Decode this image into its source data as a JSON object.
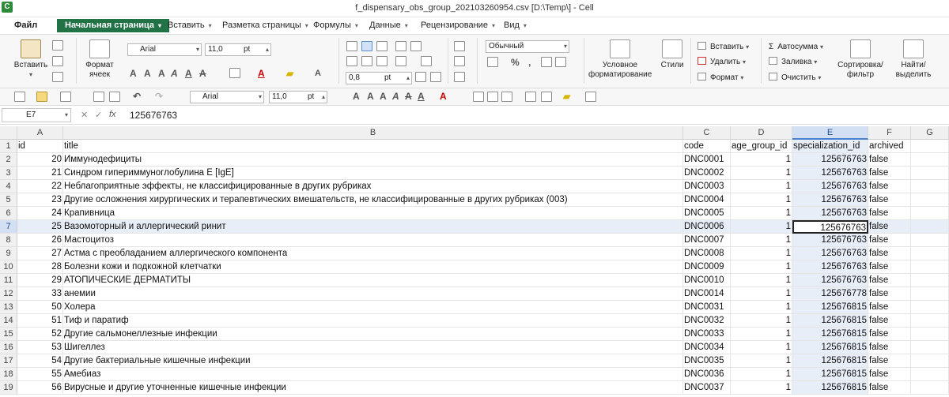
{
  "window": {
    "title": "f_dispensary_obs_group_202103260954.csv [D:\\Temp\\] - Cell"
  },
  "menu": {
    "file": "Файл",
    "tabs": [
      "Начальная страница",
      "Вставить",
      "Разметка страницы",
      "Формулы",
      "Данные",
      "Рецензирование",
      "Вид"
    ]
  },
  "ribbon": {
    "paste": "Вставить",
    "format_cells": [
      "Формат",
      "ячеек"
    ],
    "font": "Arial",
    "font_size": "11,0",
    "unit": "pt",
    "indent": "0,8",
    "number_format": "Обычный",
    "conditional": [
      "Условное",
      "форматирование"
    ],
    "styles": "Стили",
    "insert": "Вставить",
    "delete": "Удалить",
    "format": "Формат",
    "autosum": "Автосумма",
    "fill": "Заливка",
    "clear": "Очистить",
    "sort": [
      "Сортировка/",
      "фильтр"
    ],
    "find": [
      "Найти/",
      "выделить"
    ],
    "percent": "%",
    "thousands": ","
  },
  "toolbar2": {
    "font": "Arial",
    "font_size": "11,0",
    "unit": "pt"
  },
  "formula_bar": {
    "cell_ref": "E7",
    "fx": "fx",
    "value": "125676763"
  },
  "columns": [
    "A",
    "B",
    "C",
    "D",
    "E",
    "F",
    "G"
  ],
  "selected_column": "E",
  "selected_row": 7,
  "rows": [
    {
      "n": 1,
      "a": "id",
      "b": "title",
      "c": "code",
      "d": "age_group_id",
      "e": "specialization_id",
      "f": "archived",
      "header": true
    },
    {
      "n": 2,
      "a": "20",
      "b": "Иммунодефициты",
      "c": "DNC0001",
      "d": "1",
      "e": "125676763",
      "f": "false"
    },
    {
      "n": 3,
      "a": "21",
      "b": "Синдром гипериммуноглобулина Е [IgE]",
      "c": "DNC0002",
      "d": "1",
      "e": "125676763",
      "f": "false"
    },
    {
      "n": 4,
      "a": "22",
      "b": "Неблагоприятные эффекты, не классифицированные в других рубриках",
      "c": "DNC0003",
      "d": "1",
      "e": "125676763",
      "f": "false"
    },
    {
      "n": 5,
      "a": "23",
      "b": "Другие осложнения хирургических и терапевтических вмешательств, не классифицированные в других рубриках (003)",
      "c": "DNC0004",
      "d": "1",
      "e": "125676763",
      "f": "false"
    },
    {
      "n": 6,
      "a": "24",
      "b": "Крапивница",
      "c": "DNC0005",
      "d": "1",
      "e": "125676763",
      "f": "false"
    },
    {
      "n": 7,
      "a": "25",
      "b": "Вазомоторный и аллергический ринит",
      "c": "DNC0006",
      "d": "1",
      "e": "125676763",
      "f": "false"
    },
    {
      "n": 8,
      "a": "26",
      "b": "Мастоцитоз",
      "c": "DNC0007",
      "d": "1",
      "e": "125676763",
      "f": "false"
    },
    {
      "n": 9,
      "a": "27",
      "b": "Астма с преобладанием аллергического компонента",
      "c": "DNC0008",
      "d": "1",
      "e": "125676763",
      "f": "false"
    },
    {
      "n": 10,
      "a": "28",
      "b": "Болезни кожи и подкожной клетчатки",
      "c": "DNC0009",
      "d": "1",
      "e": "125676763",
      "f": "false"
    },
    {
      "n": 11,
      "a": "29",
      "b": "АТОПИЧЕСКИЕ ДЕРМАТИТЫ",
      "c": "DNC0010",
      "d": "1",
      "e": "125676763",
      "f": "false"
    },
    {
      "n": 12,
      "a": "33",
      "b": "анемии",
      "c": "DNC0014",
      "d": "1",
      "e": "125676778",
      "f": "false"
    },
    {
      "n": 13,
      "a": "50",
      "b": "Холера",
      "c": "DNC0031",
      "d": "1",
      "e": "125676815",
      "f": "false"
    },
    {
      "n": 14,
      "a": "51",
      "b": "Тиф и паратиф",
      "c": "DNC0032",
      "d": "1",
      "e": "125676815",
      "f": "false"
    },
    {
      "n": 15,
      "a": "52",
      "b": "Другие сальмонеллезные инфекции",
      "c": "DNC0033",
      "d": "1",
      "e": "125676815",
      "f": "false"
    },
    {
      "n": 16,
      "a": "53",
      "b": "Шигеллез",
      "c": "DNC0034",
      "d": "1",
      "e": "125676815",
      "f": "false"
    },
    {
      "n": 17,
      "a": "54",
      "b": "Другие бактериальные кишечные инфекции",
      "c": "DNC0035",
      "d": "1",
      "e": "125676815",
      "f": "false"
    },
    {
      "n": 18,
      "a": "55",
      "b": "Амебиаз",
      "c": "DNC0036",
      "d": "1",
      "e": "125676815",
      "f": "false"
    },
    {
      "n": 19,
      "a": "56",
      "b": "Вирусные и другие уточненные кишечные инфекции",
      "c": "DNC0037",
      "d": "1",
      "e": "125676815",
      "f": "false"
    }
  ],
  "colors": {
    "accent": "#217346",
    "selection": "#d3e0f4"
  }
}
